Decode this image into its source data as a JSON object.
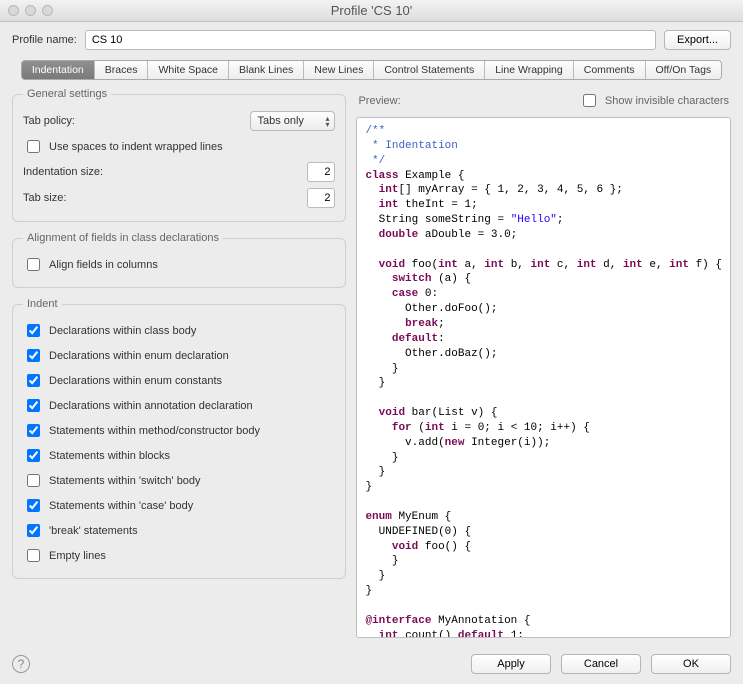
{
  "window": {
    "title": "Profile 'CS 10'"
  },
  "profile": {
    "label": "Profile name:",
    "value": "CS 10",
    "export_label": "Export..."
  },
  "tabs": [
    "Indentation",
    "Braces",
    "White Space",
    "Blank Lines",
    "New Lines",
    "Control Statements",
    "Line Wrapping",
    "Comments",
    "Off/On Tags"
  ],
  "active_tab": "Indentation",
  "groups": {
    "general": {
      "title": "General settings",
      "tab_policy_label": "Tab policy:",
      "tab_policy_value": "Tabs only",
      "use_spaces": {
        "label": "Use spaces to indent wrapped lines",
        "checked": false
      },
      "indent_size_label": "Indentation size:",
      "indent_size_value": "2",
      "tab_size_label": "Tab size:",
      "tab_size_value": "2"
    },
    "align": {
      "title": "Alignment of fields in class declarations",
      "align_fields": {
        "label": "Align fields in columns",
        "checked": false
      }
    },
    "indent": {
      "title": "Indent",
      "items": [
        {
          "label": "Declarations within class body",
          "checked": true
        },
        {
          "label": "Declarations within enum declaration",
          "checked": true
        },
        {
          "label": "Declarations within enum constants",
          "checked": true
        },
        {
          "label": "Declarations within annotation declaration",
          "checked": true
        },
        {
          "label": "Statements within method/constructor body",
          "checked": true
        },
        {
          "label": "Statements within blocks",
          "checked": true
        },
        {
          "label": "Statements within 'switch' body",
          "checked": false
        },
        {
          "label": "Statements within 'case' body",
          "checked": true
        },
        {
          "label": "'break' statements",
          "checked": true
        },
        {
          "label": "Empty lines",
          "checked": false
        }
      ]
    }
  },
  "preview": {
    "title": "Preview:",
    "show_invisible": {
      "label": "Show invisible characters",
      "checked": false
    }
  },
  "buttons": {
    "apply": "Apply",
    "cancel": "Cancel",
    "ok": "OK"
  }
}
